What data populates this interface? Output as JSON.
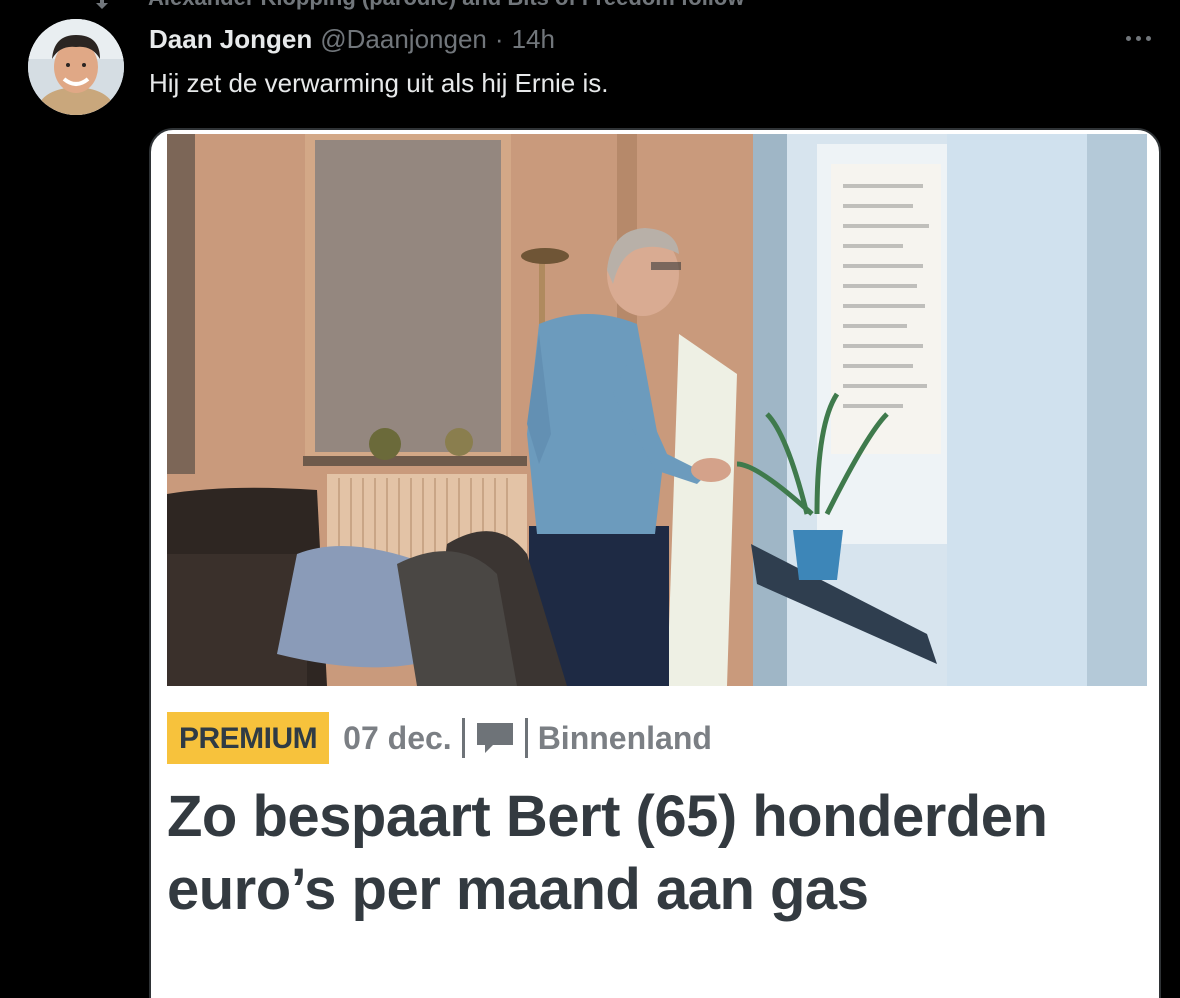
{
  "social_context": {
    "icon": "retweet-icon",
    "text": "Alexander Klöpping (parodie) and Bits of Freedom follow"
  },
  "tweet": {
    "avatar_icon": "avatar",
    "display_name": "Daan Jongen",
    "handle": "@Daanjongen",
    "separator": "·",
    "timestamp": "14h",
    "more_icon": "more-dots-icon",
    "text": "Hij zet de verwarming uit als hij Ernie is."
  },
  "article": {
    "badge": "PREMIUM",
    "date": "07 dec.",
    "comment_icon": "comment-icon",
    "category": "Binnenland",
    "headline_line1": "Zo bespaart Bert (65) honderden",
    "headline_line2": "euro’s per maand aan gas"
  },
  "colors": {
    "background": "#000000",
    "primary_text": "#e7e9ea",
    "secondary_text": "#71767b",
    "badge": "#f7c23c",
    "headline": "#333a40"
  }
}
